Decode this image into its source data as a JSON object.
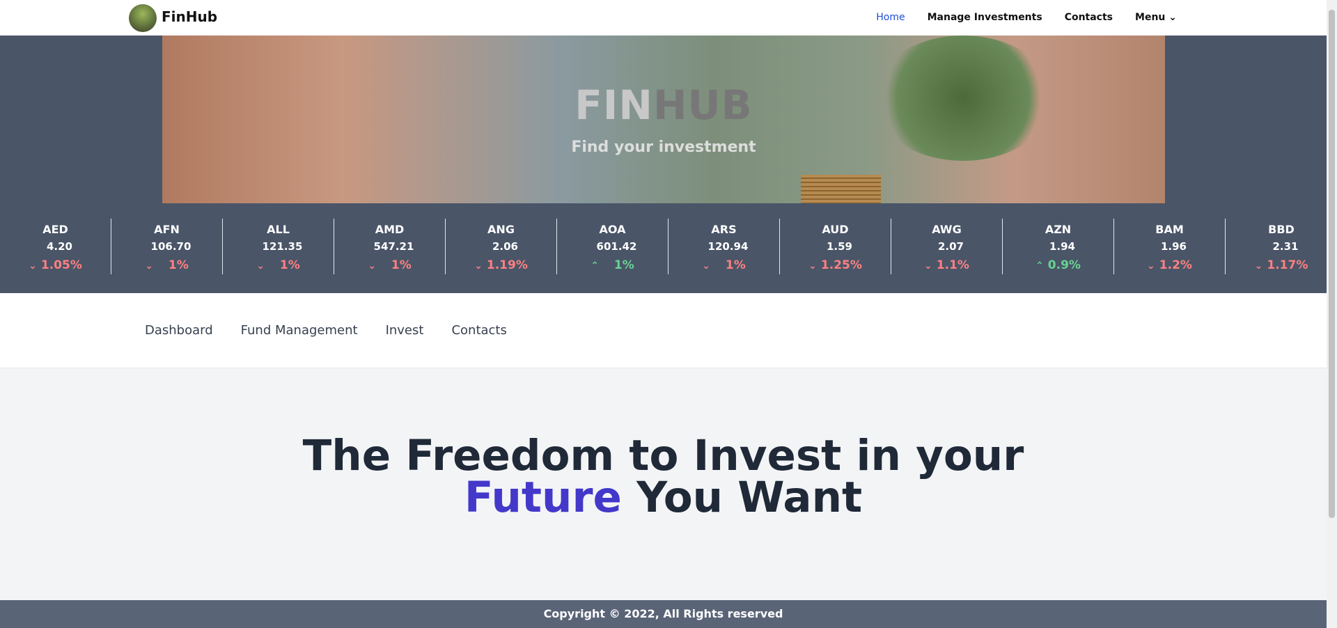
{
  "nav": {
    "brand": "FinHub",
    "links": [
      "Home",
      "Manage Investments",
      "Contacts",
      "Menu"
    ]
  },
  "banner": {
    "title_a": "FIN",
    "title_b": "HUB",
    "subtitle": "Find your investment"
  },
  "ticker": [
    {
      "code": "AED",
      "value": "4.20",
      "change": "1.05%",
      "dir": "down"
    },
    {
      "code": "AFN",
      "value": "106.70",
      "change": "1%",
      "dir": "down"
    },
    {
      "code": "ALL",
      "value": "121.35",
      "change": "1%",
      "dir": "down"
    },
    {
      "code": "AMD",
      "value": "547.21",
      "change": "1%",
      "dir": "down"
    },
    {
      "code": "ANG",
      "value": "2.06",
      "change": "1.19%",
      "dir": "down"
    },
    {
      "code": "AOA",
      "value": "601.42",
      "change": "1%",
      "dir": "up"
    },
    {
      "code": "ARS",
      "value": "120.94",
      "change": "1%",
      "dir": "down"
    },
    {
      "code": "AUD",
      "value": "1.59",
      "change": "1.25%",
      "dir": "down"
    },
    {
      "code": "AWG",
      "value": "2.07",
      "change": "1.1%",
      "dir": "down"
    },
    {
      "code": "AZN",
      "value": "1.94",
      "change": "0.9%",
      "dir": "up"
    },
    {
      "code": "BAM",
      "value": "1.96",
      "change": "1.2%",
      "dir": "down"
    },
    {
      "code": "BBD",
      "value": "2.31",
      "change": "1.17%",
      "dir": "down"
    }
  ],
  "subnav": [
    "Dashboard",
    "Fund Management",
    "Invest",
    "Contacts"
  ],
  "hero": {
    "line1": "The Freedom to Invest in your",
    "accent": "Future",
    "rest": " You Want"
  },
  "footer": "Copyright © 2022, All Rights reserved",
  "colors": {
    "up": "#68d391",
    "down": "#fc8181",
    "accent": "#4338ca",
    "link_active": "#1d4ed8"
  }
}
